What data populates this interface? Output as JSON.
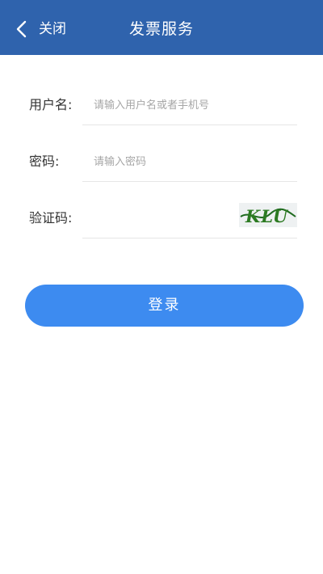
{
  "header": {
    "back_label": "关闭",
    "title": "发票服务",
    "background": "#2f63ad"
  },
  "form": {
    "username": {
      "label": "用户名:",
      "placeholder": "请输入用户名或者手机号",
      "value": ""
    },
    "password": {
      "label": "密码:",
      "placeholder": "请输入密码",
      "value": ""
    },
    "captcha": {
      "label": "验证码:",
      "placeholder": "",
      "value": "",
      "image_text": "KLU"
    }
  },
  "login": {
    "label": "登录",
    "color": "#3d8bf0"
  }
}
